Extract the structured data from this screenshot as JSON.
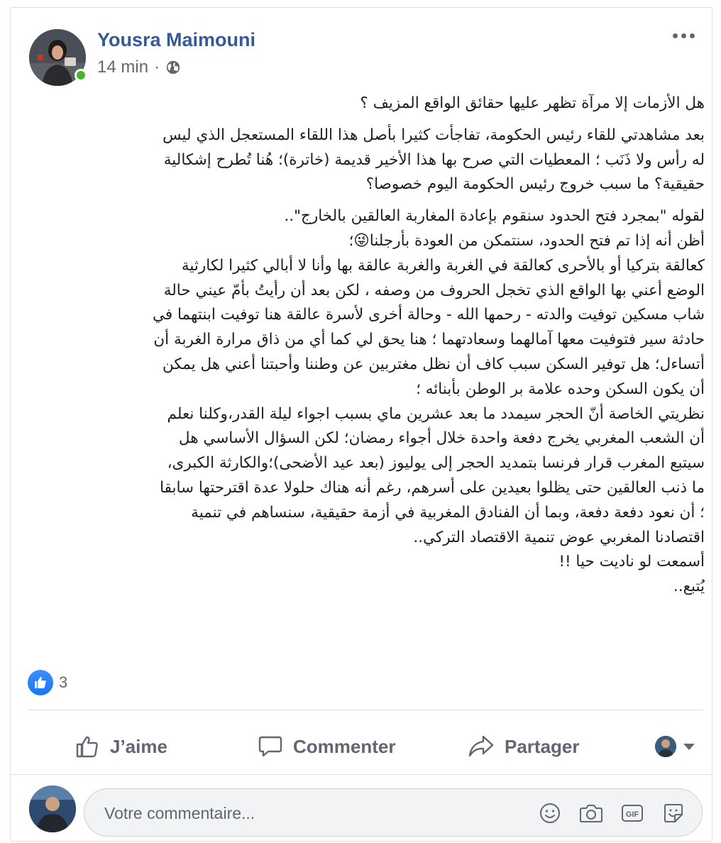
{
  "post": {
    "author": "Yousra Maimouni",
    "time": "14 min",
    "separator": "·",
    "privacy_icon": "globe-icon",
    "paragraphs": [
      [
        "هل الأزمات إلا مرآة تظهر عليها حقائق الواقع المزيف ؟"
      ],
      [
        "بعد مشاهدتي للقاء رئيس الحكومة، تفاجأت كثيرا بأصل هذا اللقاء المستعجل الذي ليس",
        "له رأس ولا ذَنَب ؛ المعطيات التي صرح بها هذا الأخير قديمة (خاترة)؛ هُنا تُطرح إشكالية",
        "حقيقية؟ ما سبب خروج رئيس الحكومة اليوم خصوصا؟"
      ],
      [
        "لقوله \"بمجرد فتح الحدود سنقوم بإعادة المغاربة العالقين بالخارج\"..",
        "أظن أنه إذا تم فتح الحدود، سنتمكن من العودة بأرجلنا😜؛",
        "كعالقة بتركيا أو بالأحرى كعالقة في الغربة والغربة عالقة بها وأنا لا أبالي كثيرا لكارثية",
        "الوضع أعني بها الواقع الذي تخجل الحروف من وصفه ، لكن بعد أن رأيتُ بأمّ عيني حالة",
        "شاب مسكين توفيت والدته - رحمها الله - وحالة أخرى لأسرة عالقة هنا توفيت ابنتهما في",
        "حادثة سير فتوفيت معها آمالهما وسعادتهما ؛ هنا يحق لي كما أي من ذاق مرارة الغربة أن",
        "أتساءل؛ هل توفير السكن سبب كاف أن نظل مغتربين عن وطننا وأحبتنا أعني هل يمكن",
        "أن يكون السكن وحده علامة بر الوطن بأبنائه ؛",
        "نظريتي الخاصة أنّ الحجر سيمدد ما بعد عشرين ماي بسبب اجواء ليلة القدر،وكلنا نعلم",
        "أن الشعب المغربي يخرج دفعة واحدة خلال أجواء رمضان؛ لكن السؤال الأساسي هل",
        "سيتبع المغرب قرار فرنسا بتمديد الحجر إلى يوليوز (بعد عيد الأضحى)؛والكارثة الكبرى،",
        "ما ذنب العالقين حتى يظلوا بعيدين على أسرهم، رغم أنه هناك حلولا عدة اقترحتها سابقا",
        "؛ أن نعود دفعة دفعة، وبما أن الفنادق المغربية في أزمة حقيقية، سنساهم في تنمية",
        "اقتصادنا المغربي عوض تنمية الاقتصاد التركي..",
        "أسمعت لو ناديت حيا !!",
        "يُتبع.."
      ]
    ],
    "reactions": {
      "icon": "like-icon",
      "count": "3"
    }
  },
  "actions": {
    "like_label": "J’aime",
    "comment_label": "Commenter",
    "share_label": "Partager"
  },
  "composer": {
    "placeholder": "Votre commentaire...",
    "icons": [
      "emoji-icon",
      "camera-icon",
      "gif-icon",
      "sticker-icon"
    ],
    "gif_text": "GIF"
  },
  "colors": {
    "author": "#385898",
    "meta": "#616770",
    "online": "#42b72a",
    "like_blue": "#1877f2",
    "action_text": "#606770"
  }
}
